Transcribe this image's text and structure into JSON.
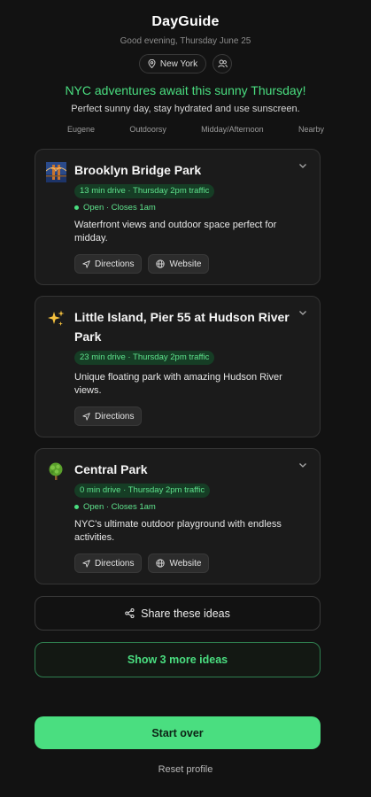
{
  "header": {
    "app_title": "DayGuide",
    "greeting": "Good evening, Thursday June 25",
    "location": "New York",
    "location_icon": "map-pin-icon",
    "profile_icon": "users-icon"
  },
  "headline": "NYC adventures await this sunny Thursday!",
  "tip": "Perfect sunny day, stay hydrated and use sunscreen.",
  "tags": [
    "Eugene",
    "Outdoorsy",
    "Midday/Afternoon",
    "Nearby"
  ],
  "cards": [
    {
      "title": "Brooklyn Bridge Park",
      "icon": "bridge-photo-icon",
      "travel": "13 min drive · Thursday 2pm traffic",
      "status": "Open · Closes 1am",
      "description": "Waterfront views and outdoor space perfect for midday.",
      "directions_label": "Directions",
      "website_label": "Website"
    },
    {
      "title": "Little Island, Pier 55 at Hudson River Park",
      "icon": "sparkles-icon",
      "travel": "23 min drive · Thursday 2pm traffic",
      "description": "Unique floating park with amazing Hudson River views.",
      "directions_label": "Directions"
    },
    {
      "title": "Central Park",
      "icon": "tree-icon",
      "travel": "0 min drive · Thursday 2pm traffic",
      "status": "Open · Closes 1am",
      "description": "NYC's ultimate outdoor playground with endless activities.",
      "directions_label": "Directions",
      "website_label": "Website"
    }
  ],
  "share_label": "Share these ideas",
  "more_label": "Show 3 more ideas",
  "start_over_label": "Start over",
  "reset_label": "Reset profile",
  "colors": {
    "accent": "#4ade80",
    "background": "#121212",
    "card": "#1b1b1b"
  }
}
